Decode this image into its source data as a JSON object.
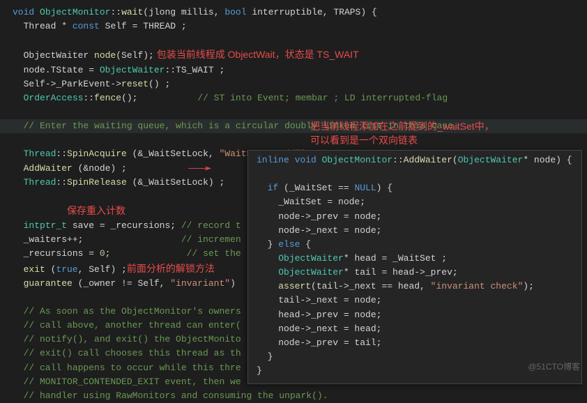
{
  "main": {
    "l1_kw": "void",
    "l1_type": "ObjectMonitor",
    "l1_fn": "wait",
    "l1_params": "(jlong millis, ",
    "l1_kw2": "bool",
    "l1_p2": " interruptible, TRAPS) {",
    "l2_a": "  Thread * ",
    "l2_kw": "const",
    "l2_b": " Self = THREAD ;",
    "l4_a": "  ObjectWaiter ",
    "l4_fn": "node",
    "l4_b": "(Self);",
    "l5_a": "  node.TState = ",
    "l5_type": "ObjectWaiter",
    "l5_b": "::TS_WAIT ;",
    "l6_a": "  Self->_ParkEvent->",
    "l6_fn": "reset",
    "l6_b": "() ;",
    "l7_a": "  ",
    "l7_type": "OrderAccess",
    "l7_b": "::",
    "l7_fn": "fence",
    "l7_c": "();",
    "l7_comment": "           // ST into Event; membar ; LD interrupted-flag",
    "l9_comment": "  // Enter the waiting queue, which is a circular doubly linked list in this case…",
    "l11_a": "  ",
    "l11_type": "Thread",
    "l11_b": "::",
    "l11_fn": "SpinAcquire",
    "l11_c": " (&_WaitSetLock, ",
    "l11_str": "\"WaitSet - add\"",
    "l11_d": ") ;",
    "l12_a": "  ",
    "l12_fn": "AddWaiter",
    "l12_b": " (&node) ;",
    "l13_a": "  ",
    "l13_type": "Thread",
    "l13_b": "::",
    "l13_fn": "SpinRelease",
    "l13_c": " (&_WaitSetLock) ;",
    "l16_a": "  ",
    "l16_type": "intptr_t",
    "l16_b": " save = _recursions;",
    "l16_comment": " // record t",
    "l17_a": "  _waiters++;",
    "l17_comment": "                  // incremen",
    "l18_a": "  _recursions = ",
    "l18_num": "0",
    "l18_b": ";",
    "l18_comment": "              // set the ",
    "l19_a": "  ",
    "l19_fn": "exit",
    "l19_b": " (",
    "l19_kw": "true",
    "l19_c": ", Self) ;",
    "l20_a": "  ",
    "l20_fn": "guarantee",
    "l20_b": " (_owner != Self, ",
    "l20_str": "\"invariant\"",
    "l20_c": ")",
    "l22_comment": "  // As soon as the ObjectMonitor's owners",
    "l23_comment": "  // call above, another thread can enter(",
    "l24_comment": "  // notify(), and exit() the ObjectMonito",
    "l25_comment": "  // exit() call chooses this thread as th",
    "l26_comment": "  // call happens to occur while this thre",
    "l27_comment": "  // MONITOR_CONTENDED_EXIT event, then we",
    "l28_comment": "  // handler using RawMonitors and consuming the unpark()."
  },
  "annot": {
    "a1": " 包装当前线程成 ObjectWait，状态是 TS_WAIT",
    "a2_l1": "把当前线程添加在之前提到的_waitSet中，",
    "a2_l2": "可以看到是一个双向链表",
    "a3": "保存重入计数",
    "a4": "前面分析的解锁方法"
  },
  "popup": {
    "l1_kw": "inline void",
    "l1_type": " ObjectMonitor",
    "l1_b": "::",
    "l1_fn": "AddWaiter",
    "l1_c": "(",
    "l1_type2": "ObjectWaiter",
    "l1_d": "* node) {",
    "l3_a": "  ",
    "l3_kw": "if",
    "l3_b": " (_WaitSet == ",
    "l3_const": "NULL",
    "l3_c": ") {",
    "l4": "    _WaitSet = node;",
    "l5": "    node->_prev = node;",
    "l6": "    node->_next = node;",
    "l7_a": "  } ",
    "l7_kw": "else",
    "l7_b": " {",
    "l8_a": "    ",
    "l8_type": "ObjectWaiter",
    "l8_b": "* head = _WaitSet ;",
    "l9_a": "    ",
    "l9_type": "ObjectWaiter",
    "l9_b": "* tail = head->_prev;",
    "l10_a": "    ",
    "l10_fn": "assert",
    "l10_b": "(tail->_next == head, ",
    "l10_str": "\"invariant check\"",
    "l10_c": ");",
    "l11": "    tail->_next = node;",
    "l12": "    head->_prev = node;",
    "l13": "    node->_next = head;",
    "l14": "    node->_prev = tail;",
    "l15": "  }",
    "l16": "}"
  },
  "watermark": "@51CTO博客"
}
